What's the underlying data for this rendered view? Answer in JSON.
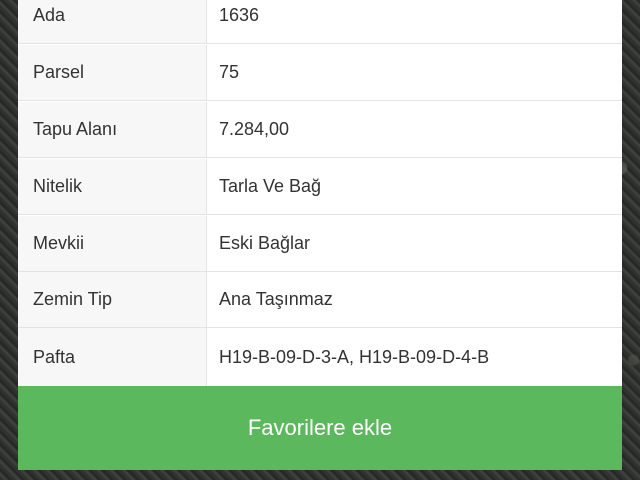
{
  "details": {
    "rows": [
      {
        "label": "Ada",
        "value": "1636"
      },
      {
        "label": "Parsel",
        "value": "75"
      },
      {
        "label": "Tapu Alanı",
        "value": "7.284,00"
      },
      {
        "label": "Nitelik",
        "value": "Tarla Ve Bağ"
      },
      {
        "label": "Mevkii",
        "value": "Eski Bağlar"
      },
      {
        "label": "Zemin Tip",
        "value": "Ana Taşınmaz"
      },
      {
        "label": "Pafta",
        "value": "H19-B-09-D-3-A, H19-B-09-D-4-B"
      }
    ]
  },
  "actions": {
    "favorite_label": "Favorilere ekle"
  },
  "colors": {
    "button": "#5cb85c",
    "text": "#333333",
    "border": "#e3e3e3"
  }
}
